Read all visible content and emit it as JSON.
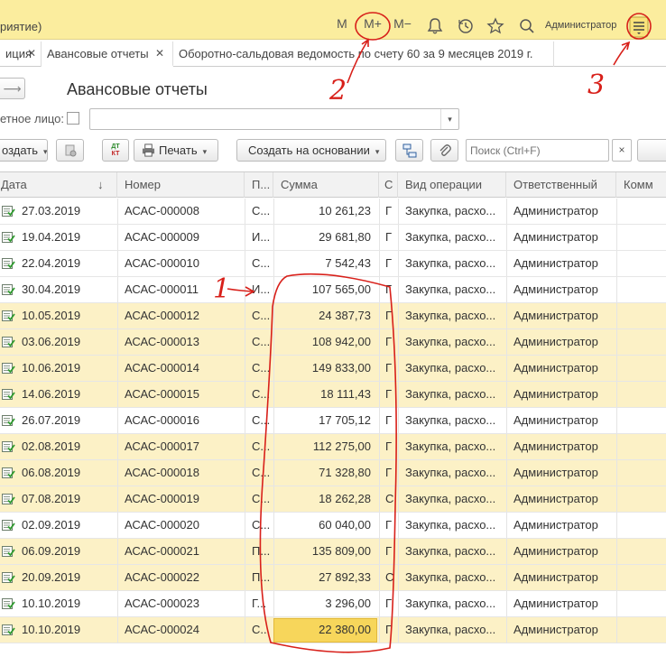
{
  "app": {
    "title": "риятие)",
    "m_label": "M",
    "m_plus_label": "M+",
    "m_minus_label": "M−",
    "user": "Администратор",
    "icons": [
      "bell-icon",
      "history-icon",
      "star-icon",
      "search-icon",
      "menu-icon"
    ]
  },
  "tabs": [
    {
      "label": "иция"
    },
    {
      "label": "Авансовые отчеты"
    },
    {
      "label": "Оборотно-сальдовая ведомость по счету 60 за 9 месяцев 2019 г."
    }
  ],
  "page": {
    "title": "Авансовые отчеты",
    "filter_label": "етное лицо:",
    "filter_value": ""
  },
  "toolbar": {
    "create_label": "оздать",
    "print_label": "Печать",
    "create_based_label": "Создать на основании",
    "search_placeholder": "Поиск (Ctrl+F)",
    "search_clear": "×",
    "dtkt_top": "ДТ",
    "dtkt_bottom": "КТ"
  },
  "table": {
    "columns": [
      {
        "label": "Дата"
      },
      {
        "label": "Номер"
      },
      {
        "label": "П..."
      },
      {
        "label": "Сумма"
      },
      {
        "label": "С"
      },
      {
        "label": "Вид операции"
      },
      {
        "label": "Ответственный"
      },
      {
        "label": "Комм"
      }
    ],
    "sort_indicator": "↓",
    "rows": [
      {
        "date": "27.03.2019",
        "number": "АСАС-000008",
        "p": "С...",
        "sum": "10 261,23",
        "s": "Г",
        "op": "Закупка, расхо...",
        "resp": "Администратор",
        "hl": false
      },
      {
        "date": "19.04.2019",
        "number": "АСАС-000009",
        "p": "И...",
        "sum": "29 681,80",
        "s": "Г",
        "op": "Закупка, расхо...",
        "resp": "Администратор",
        "hl": false
      },
      {
        "date": "22.04.2019",
        "number": "АСАС-000010",
        "p": "С...",
        "sum": "7 542,43",
        "s": "Г",
        "op": "Закупка, расхо...",
        "resp": "Администратор",
        "hl": false
      },
      {
        "date": "30.04.2019",
        "number": "АСАС-000011",
        "p": "И...",
        "sum": "107 565,00",
        "s": "Г",
        "op": "Закупка, расхо...",
        "resp": "Администратор",
        "hl": false
      },
      {
        "date": "10.05.2019",
        "number": "АСАС-000012",
        "p": "С...",
        "sum": "24 387,73",
        "s": "Г",
        "op": "Закупка, расхо...",
        "resp": "Администратор",
        "hl": true
      },
      {
        "date": "03.06.2019",
        "number": "АСАС-000013",
        "p": "С...",
        "sum": "108 942,00",
        "s": "Г",
        "op": "Закупка, расхо...",
        "resp": "Администратор",
        "hl": true
      },
      {
        "date": "10.06.2019",
        "number": "АСАС-000014",
        "p": "С...",
        "sum": "149 833,00",
        "s": "Г",
        "op": "Закупка, расхо...",
        "resp": "Администратор",
        "hl": true
      },
      {
        "date": "14.06.2019",
        "number": "АСАС-000015",
        "p": "С...",
        "sum": "18 111,43",
        "s": "Г",
        "op": "Закупка, расхо...",
        "resp": "Администратор",
        "hl": true
      },
      {
        "date": "26.07.2019",
        "number": "АСАС-000016",
        "p": "С...",
        "sum": "17 705,12",
        "s": "Г",
        "op": "Закупка, расхо...",
        "resp": "Администратор",
        "hl": false
      },
      {
        "date": "02.08.2019",
        "number": "АСАС-000017",
        "p": "С...",
        "sum": "112 275,00",
        "s": "Г",
        "op": "Закупка, расхо...",
        "resp": "Администратор",
        "hl": true
      },
      {
        "date": "06.08.2019",
        "number": "АСАС-000018",
        "p": "С...",
        "sum": "71 328,80",
        "s": "Г",
        "op": "Закупка, расхо...",
        "resp": "Администратор",
        "hl": true
      },
      {
        "date": "07.08.2019",
        "number": "АСАС-000019",
        "p": "С...",
        "sum": "18 262,28",
        "s": "С",
        "op": "Закупка, расхо...",
        "resp": "Администратор",
        "hl": true
      },
      {
        "date": "02.09.2019",
        "number": "АСАС-000020",
        "p": "С...",
        "sum": "60 040,00",
        "s": "Г",
        "op": "Закупка, расхо...",
        "resp": "Администратор",
        "hl": false
      },
      {
        "date": "06.09.2019",
        "number": "АСАС-000021",
        "p": "П...",
        "sum": "135 809,00",
        "s": "Г",
        "op": "Закупка, расхо...",
        "resp": "Администратор",
        "hl": true
      },
      {
        "date": "20.09.2019",
        "number": "АСАС-000022",
        "p": "П...",
        "sum": "27 892,33",
        "s": "С",
        "op": "Закупка, расхо...",
        "resp": "Администратор",
        "hl": true
      },
      {
        "date": "10.10.2019",
        "number": "АСАС-000023",
        "p": "Г...",
        "sum": "3 296,00",
        "s": "Г",
        "op": "Закупка, расхо...",
        "resp": "Администратор",
        "hl": false
      },
      {
        "date": "10.10.2019",
        "number": "АСАС-000024",
        "p": "С...",
        "sum": "22 380,00",
        "s": "Г",
        "op": "Закупка, расхо...",
        "resp": "Администратор",
        "hl": true,
        "selected": true
      }
    ]
  },
  "annotations": {
    "color": "#d8201a",
    "labels": [
      "1",
      "2",
      "3"
    ]
  }
}
